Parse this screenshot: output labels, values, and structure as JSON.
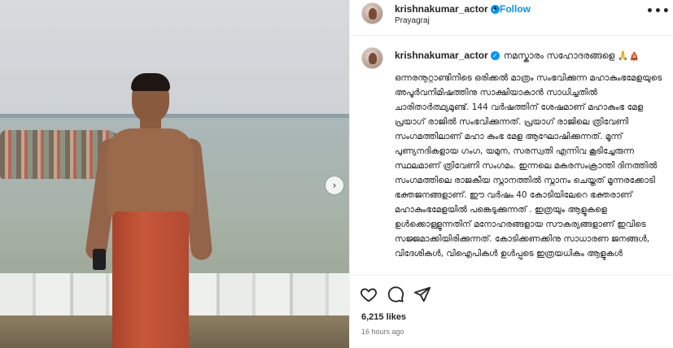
{
  "post": {
    "username": "krishnakumar_actor",
    "verified_mark": "✓",
    "separator": "•",
    "follow_label": "Follow",
    "location": "Prayagraj",
    "more_label": "•••"
  },
  "caption": {
    "username": "krishnakumar_actor",
    "greeting": "നമസ്കാരം സഹോദരങ്ങളെ 🙏🛕",
    "text": "ഒന്നരനൂറ്റാണ്ടിനിടെ ഒരിക്കൽ മാത്രം സംഭവിക്കുന്ന മഹാകുംഭമേളയുടെ അപൂർവനിമിഷത്തിനു സാക്ഷിയാകാൻ സാധിച്ചതിൽ ചാരിതാർത്ഥ്യമുണ്ട്. 144 വർഷത്തിന് ശേഷമാണ് മഹാകുംഭ മേള പ്രയാഗ് രാജിൽ സംഭവിക്കുന്നത്. പ്രയാഗ് രാജിലെ ത്രിവേണി സംഗമത്തിലാണ് മഹാ കുംഭ മേള ആഘോഷിക്കുന്നത്. മൂന്ന് പുണ്യനദികളായ ഗംഗ, യമുന, സരസ്വതി എന്നിവ കൂടിച്ചേരുന്ന സ്ഥലമാണ് ത്രിവേണി സംഗമം. ഇന്നലെ മകരസംക്രാന്തി ദിനത്തിൽ സംഗമത്തിലെ രാജകീയ സ്നാനത്തിൽ സ്നാനം ചെയ്തത് മൂന്നരക്കോടി ഭക്തജനങ്ങളാണ്. ഈ വർഷം 40 കോടിയിലേറെ ഭക്തരാണ് മഹാകുംഭമേളയിൽ പങ്കെടുക്കുന്നത് . ഇത്രയും ആളുകളെ ഉൾക്കൊള്ളുന്നതിന് മനോഹരങ്ങളായ സൗകര്യങ്ങളാണ് ഇവിടെ സജ്ജമാക്കിയിരിക്കുന്നത്. കോടിക്കണക്കിനു സാധാരണ ജനങ്ങൾ, വിദേശികൾ, വിഐപികൾ ഉൾപ്പടെ ഇത്രയധികം ആളുകൾ"
  },
  "actions": {
    "like_icon": "heart-icon",
    "comment_icon": "comment-icon",
    "share_icon": "share-icon",
    "next_icon": "chevron-right-icon",
    "next_glyph": "›"
  },
  "stats": {
    "likes": "6,215 likes",
    "time": "16 hours ago"
  }
}
